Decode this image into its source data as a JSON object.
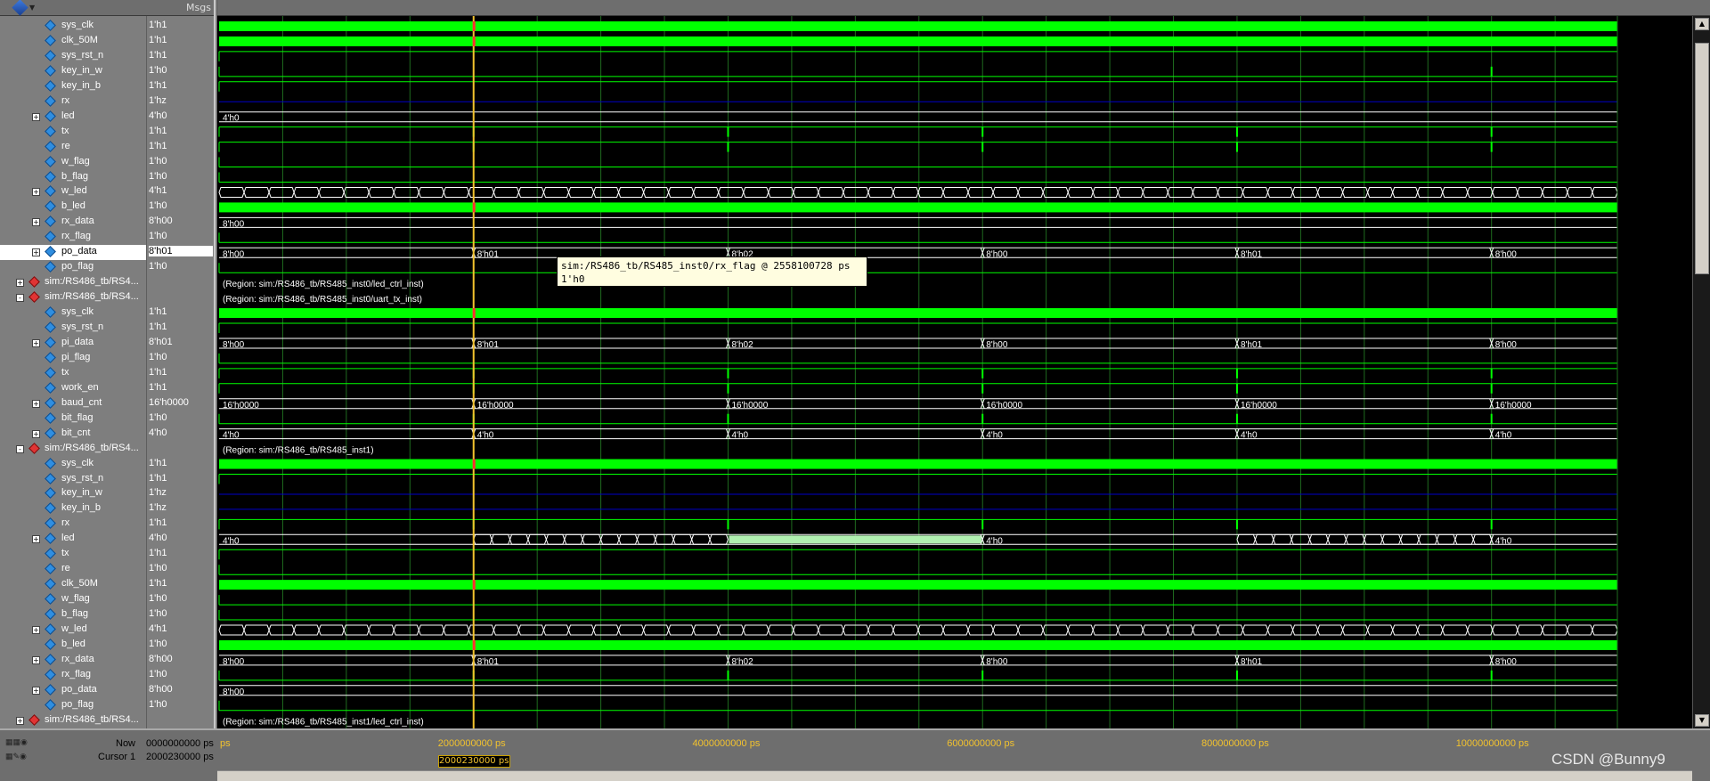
{
  "header": {
    "msgs_label": "Msgs"
  },
  "tooltip": {
    "line1": "sim:/RS486_tb/RS485_inst0/rx_flag @ 2558100728 ps",
    "line2": "1'h0"
  },
  "signals": [
    {
      "name": "sys_clk",
      "value": "1'h1",
      "level": 2,
      "icon": "signal-icon",
      "wave": "clock"
    },
    {
      "name": "clk_50M",
      "value": "1'h1",
      "level": 2,
      "icon": "signal-icon",
      "wave": "clock"
    },
    {
      "name": "sys_rst_n",
      "value": "1'h1",
      "level": 2,
      "icon": "signal-icon",
      "wave": "high"
    },
    {
      "name": "key_in_w",
      "value": "1'h0",
      "level": 2,
      "icon": "signal-icon",
      "wave": "low",
      "pulses": [
        0.91
      ]
    },
    {
      "name": "key_in_b",
      "value": "1'h1",
      "level": 2,
      "icon": "signal-icon",
      "wave": "high"
    },
    {
      "name": "rx",
      "value": "1'hz",
      "level": 2,
      "icon": "signal-icon",
      "wave": "z"
    },
    {
      "name": "led",
      "value": "4'h0",
      "level": 2,
      "icon": "signal-icon",
      "expand": "+",
      "wave": "bus",
      "segments": [
        {
          "x": 0,
          "label": "4'h0"
        }
      ]
    },
    {
      "name": "tx",
      "value": "1'h1",
      "level": 2,
      "icon": "signal-icon",
      "wave": "high",
      "pulses": [
        0.182,
        0.364,
        0.546,
        0.728,
        0.91
      ]
    },
    {
      "name": "re",
      "value": "1'h1",
      "level": 2,
      "icon": "signal-icon",
      "wave": "high",
      "pulses": [
        0.182,
        0.364,
        0.546,
        0.728,
        0.91
      ]
    },
    {
      "name": "w_flag",
      "value": "1'h0",
      "level": 2,
      "icon": "signal-icon",
      "wave": "low"
    },
    {
      "name": "b_flag",
      "value": "1'h0",
      "level": 2,
      "icon": "signal-icon",
      "wave": "low"
    },
    {
      "name": "w_led",
      "value": "4'h1",
      "level": 2,
      "icon": "signal-icon",
      "expand": "+",
      "wave": "dense"
    },
    {
      "name": "b_led",
      "value": "1'h0",
      "level": 2,
      "icon": "signal-icon",
      "wave": "clock"
    },
    {
      "name": "rx_data",
      "value": "8'h00",
      "level": 2,
      "icon": "signal-icon",
      "expand": "+",
      "wave": "bus",
      "segments": [
        {
          "x": 0,
          "label": "8'h00"
        }
      ]
    },
    {
      "name": "rx_flag",
      "value": "1'h0",
      "level": 2,
      "icon": "signal-icon",
      "wave": "low"
    },
    {
      "name": "po_data",
      "value": "8'h01",
      "level": 2,
      "icon": "signal-icon",
      "expand": "+",
      "selected": true,
      "wave": "bus",
      "segments": [
        {
          "x": 0,
          "label": "8'h00"
        },
        {
          "x": 0.182,
          "label": "8'h01"
        },
        {
          "x": 0.364,
          "label": "8'h02"
        },
        {
          "x": 0.546,
          "label": "8'h00"
        },
        {
          "x": 0.728,
          "label": "8'h01"
        },
        {
          "x": 0.91,
          "label": "8'h00"
        }
      ]
    },
    {
      "name": "po_flag",
      "value": "1'h0",
      "level": 2,
      "icon": "signal-icon",
      "wave": "low"
    },
    {
      "name": "sim:/RS486_tb/RS4...",
      "value": "",
      "level": 0,
      "icon": "region-icon",
      "expand": "+",
      "wave": "region",
      "region": "(Region: sim:/RS486_tb/RS485_inst0/led_ctrl_inst)"
    },
    {
      "name": "sim:/RS486_tb/RS4...",
      "value": "",
      "level": 0,
      "icon": "region-icon",
      "expand": "-",
      "wave": "region",
      "region": "(Region: sim:/RS486_tb/RS485_inst0/uart_tx_inst)"
    },
    {
      "name": "sys_clk",
      "value": "1'h1",
      "level": 2,
      "icon": "signal-icon",
      "wave": "clock"
    },
    {
      "name": "sys_rst_n",
      "value": "1'h1",
      "level": 2,
      "icon": "signal-icon",
      "wave": "high"
    },
    {
      "name": "pi_data",
      "value": "8'h01",
      "level": 2,
      "icon": "signal-icon",
      "expand": "+",
      "wave": "bus",
      "segments": [
        {
          "x": 0,
          "label": "8'h00"
        },
        {
          "x": 0.182,
          "label": "8'h01"
        },
        {
          "x": 0.364,
          "label": "8'h02"
        },
        {
          "x": 0.546,
          "label": "8'h00"
        },
        {
          "x": 0.728,
          "label": "8'h01"
        },
        {
          "x": 0.91,
          "label": "8'h00"
        }
      ]
    },
    {
      "name": "pi_flag",
      "value": "1'h0",
      "level": 2,
      "icon": "signal-icon",
      "wave": "low"
    },
    {
      "name": "tx",
      "value": "1'h1",
      "level": 2,
      "icon": "signal-icon",
      "wave": "high",
      "pulses": [
        0.182,
        0.364,
        0.546,
        0.728,
        0.91
      ]
    },
    {
      "name": "work_en",
      "value": "1'h1",
      "level": 2,
      "icon": "signal-icon",
      "wave": "high",
      "pulses": [
        0.182,
        0.364,
        0.546,
        0.728,
        0.91
      ]
    },
    {
      "name": "baud_cnt",
      "value": "16'h0000",
      "level": 2,
      "icon": "signal-icon",
      "expand": "+",
      "wave": "bus",
      "segments": [
        {
          "x": 0,
          "label": "16'h0000"
        },
        {
          "x": 0.182,
          "label": "16'h0000"
        },
        {
          "x": 0.364,
          "label": "16'h0000"
        },
        {
          "x": 0.546,
          "label": "16'h0000"
        },
        {
          "x": 0.728,
          "label": "16'h0000"
        },
        {
          "x": 0.91,
          "label": "16'h0000"
        }
      ]
    },
    {
      "name": "bit_flag",
      "value": "1'h0",
      "level": 2,
      "icon": "signal-icon",
      "wave": "low",
      "pulses": [
        0.182,
        0.364,
        0.546,
        0.728,
        0.91
      ]
    },
    {
      "name": "bit_cnt",
      "value": "4'h0",
      "level": 2,
      "icon": "signal-icon",
      "expand": "+",
      "wave": "bus",
      "segments": [
        {
          "x": 0,
          "label": "4'h0"
        },
        {
          "x": 0.182,
          "label": "4'h0"
        },
        {
          "x": 0.364,
          "label": "4'h0"
        },
        {
          "x": 0.546,
          "label": "4'h0"
        },
        {
          "x": 0.728,
          "label": "4'h0"
        },
        {
          "x": 0.91,
          "label": "4'h0"
        }
      ]
    },
    {
      "name": "sim:/RS486_tb/RS4...",
      "value": "",
      "level": 0,
      "icon": "region-icon",
      "expand": "-",
      "wave": "region",
      "region": "(Region: sim:/RS486_tb/RS485_inst1)"
    },
    {
      "name": "sys_clk",
      "value": "1'h1",
      "level": 2,
      "icon": "signal-icon",
      "wave": "clock"
    },
    {
      "name": "sys_rst_n",
      "value": "1'h1",
      "level": 2,
      "icon": "signal-icon",
      "wave": "high"
    },
    {
      "name": "key_in_w",
      "value": "1'hz",
      "level": 2,
      "icon": "signal-icon",
      "wave": "z"
    },
    {
      "name": "key_in_b",
      "value": "1'hz",
      "level": 2,
      "icon": "signal-icon",
      "wave": "z"
    },
    {
      "name": "rx",
      "value": "1'h1",
      "level": 2,
      "icon": "signal-icon",
      "wave": "high",
      "pulses": [
        0.182,
        0.364,
        0.546,
        0.728,
        0.91
      ]
    },
    {
      "name": "led",
      "value": "4'h0",
      "level": 2,
      "icon": "signal-icon",
      "expand": "+",
      "wave": "ledbus",
      "segments": [
        {
          "x": 0,
          "label": "4'h0"
        },
        {
          "x": 0.546,
          "label": "4'h0"
        },
        {
          "x": 0.91,
          "label": "4'h0"
        }
      ]
    },
    {
      "name": "tx",
      "value": "1'h1",
      "level": 2,
      "icon": "signal-icon",
      "wave": "high"
    },
    {
      "name": "re",
      "value": "1'h0",
      "level": 2,
      "icon": "signal-icon",
      "wave": "low"
    },
    {
      "name": "clk_50M",
      "value": "1'h1",
      "level": 2,
      "icon": "signal-icon",
      "wave": "clock"
    },
    {
      "name": "w_flag",
      "value": "1'h0",
      "level": 2,
      "icon": "signal-icon",
      "wave": "low"
    },
    {
      "name": "b_flag",
      "value": "1'h0",
      "level": 2,
      "icon": "signal-icon",
      "wave": "low"
    },
    {
      "name": "w_led",
      "value": "4'h1",
      "level": 2,
      "icon": "signal-icon",
      "expand": "+",
      "wave": "dense"
    },
    {
      "name": "b_led",
      "value": "1'h0",
      "level": 2,
      "icon": "signal-icon",
      "wave": "clock"
    },
    {
      "name": "rx_data",
      "value": "8'h00",
      "level": 2,
      "icon": "signal-icon",
      "expand": "+",
      "wave": "bus",
      "segments": [
        {
          "x": 0,
          "label": "8'h00"
        },
        {
          "x": 0.182,
          "label": "8'h01"
        },
        {
          "x": 0.364,
          "label": "8'h02"
        },
        {
          "x": 0.546,
          "label": "8'h00"
        },
        {
          "x": 0.728,
          "label": "8'h01"
        },
        {
          "x": 0.91,
          "label": "8'h00"
        }
      ]
    },
    {
      "name": "rx_flag",
      "value": "1'h0",
      "level": 2,
      "icon": "signal-icon",
      "wave": "low",
      "pulses": [
        0.182,
        0.364,
        0.546,
        0.728,
        0.91
      ]
    },
    {
      "name": "po_data",
      "value": "8'h00",
      "level": 2,
      "icon": "signal-icon",
      "expand": "+",
      "wave": "bus",
      "segments": [
        {
          "x": 0,
          "label": "8'h00"
        }
      ]
    },
    {
      "name": "po_flag",
      "value": "1'h0",
      "level": 2,
      "icon": "signal-icon",
      "wave": "low"
    },
    {
      "name": "sim:/RS486_tb/RS4...",
      "value": "",
      "level": 0,
      "icon": "region-icon",
      "expand": "+",
      "wave": "region",
      "region": "(Region: sim:/RS486_tb/RS485_inst1/led_ctrl_inst)"
    }
  ],
  "timeline": {
    "start_label": "ps",
    "ticks": [
      {
        "x": 0.182,
        "label": "2000000000 ps"
      },
      {
        "x": 0.364,
        "label": "4000000000 ps"
      },
      {
        "x": 0.546,
        "label": "6000000000 ps"
      },
      {
        "x": 0.728,
        "label": "8000000000 ps"
      },
      {
        "x": 0.91,
        "label": "10000000000 ps"
      }
    ]
  },
  "cursor": {
    "x": 0.182
  },
  "status": {
    "now_label": "Now",
    "now_value": "0000000000 ps",
    "cursor_label": "Cursor 1",
    "cursor_value": "2000230000 ps",
    "cursor_box": "2000230000 ps"
  },
  "watermark": "CSDN @Bunny9",
  "colors": {
    "wave_green": "#00ff00",
    "z_blue": "#0000c8",
    "cursor_yellow": "#f2c22e",
    "cursor_red": "#ff3030"
  }
}
